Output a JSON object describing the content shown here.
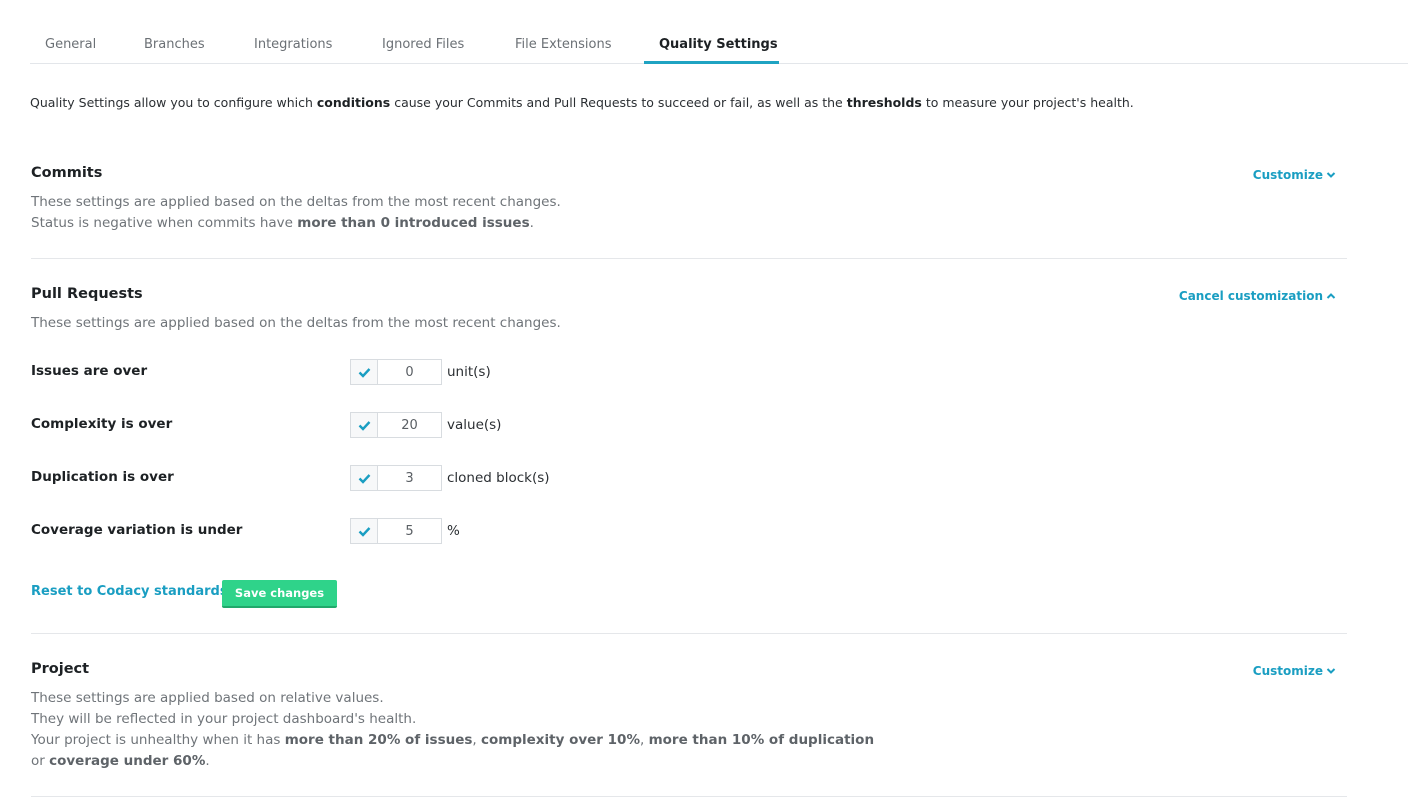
{
  "tabs": [
    {
      "label": "General"
    },
    {
      "label": "Branches"
    },
    {
      "label": "Integrations"
    },
    {
      "label": "Ignored Files"
    },
    {
      "label": "File Extensions"
    },
    {
      "label": "Quality Settings"
    }
  ],
  "active_tab": "Quality Settings",
  "intro": {
    "pre": "Quality Settings allow you to configure which ",
    "b1": "conditions",
    "mid": " cause your Commits and Pull Requests to succeed or fail, as well as the ",
    "b2": "thresholds",
    "post": " to measure your project's health."
  },
  "commits": {
    "title": "Commits",
    "action": "Customize",
    "line1": "These settings are applied based on the deltas from the most recent changes.",
    "line2_pre": "Status is negative when commits have ",
    "line2_bold": "more than 0 introduced issues",
    "line2_post": "."
  },
  "pull_requests": {
    "title": "Pull Requests",
    "action": "Cancel customization",
    "line1": "These settings are applied based on the deltas from the most recent changes.",
    "rows": [
      {
        "label": "Issues are over",
        "checked": true,
        "value": "0",
        "unit": "unit(s)"
      },
      {
        "label": "Complexity is over",
        "checked": true,
        "value": "20",
        "unit": "value(s)"
      },
      {
        "label": "Duplication is over",
        "checked": true,
        "value": "3",
        "unit": "cloned block(s)"
      },
      {
        "label": "Coverage variation is under",
        "checked": true,
        "value": "5",
        "unit": "%"
      }
    ],
    "reset_label": "Reset to Codacy standards",
    "save_label": "Save changes"
  },
  "project": {
    "title": "Project",
    "action": "Customize",
    "line1": "These settings are applied based on relative values.",
    "line2": "They will be reflected in your project dashboard's health.",
    "line3_pre": "Your project is unhealthy when it has ",
    "line3_b1": "more than 20% of issues",
    "line3_sep1": ", ",
    "line3_b2": "complexity over 10%",
    "line3_sep2": ", ",
    "line3_b3": "more than 10% of duplication",
    "line4_pre": "or ",
    "line4_b": "coverage under 60%",
    "line4_post": "."
  },
  "colors": {
    "accent": "#1fa3c2",
    "link": "#1a9ec2",
    "save": "#2fd38a"
  }
}
